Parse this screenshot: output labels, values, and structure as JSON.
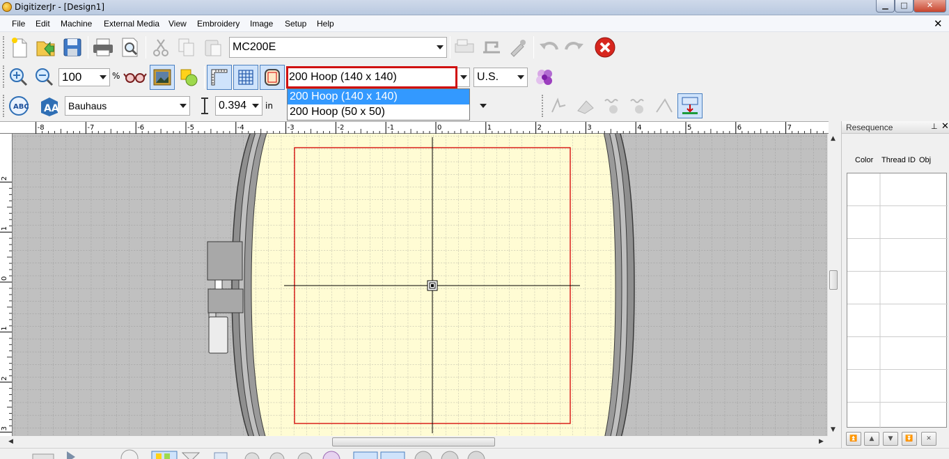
{
  "window": {
    "title": "DigitizerJr - [Design1]",
    "controls": {
      "minimize": "▁",
      "maximize": "□",
      "close": "✕"
    }
  },
  "menu": {
    "items": [
      "File",
      "Edit",
      "Machine",
      "External Media",
      "View",
      "Embroidery",
      "Image",
      "Setup",
      "Help"
    ],
    "doc_close": "✕"
  },
  "toolbar1": {
    "machine_select": "MC200E"
  },
  "toolbar2": {
    "zoom_value": "100",
    "zoom_unit": "%",
    "hoop_select": "200 Hoop (140 x 140)",
    "units_select": "U.S."
  },
  "hoop_dropdown": {
    "options": [
      "200 Hoop (140 x 140)",
      "200 Hoop (50 x 50)"
    ],
    "selected_index": 0
  },
  "toolbar3": {
    "font_select": "Bauhaus",
    "size_value": "0.394",
    "size_unit": "in"
  },
  "ruler": {
    "top_labels": [
      "-8",
      "-7",
      "-6",
      "-5",
      "-4",
      "-3",
      "-2",
      "-1",
      "0",
      "1",
      "2",
      "3",
      "4",
      "5",
      "6",
      "7"
    ],
    "left_labels": [
      "2",
      "1",
      "0",
      "1",
      "2",
      "3"
    ]
  },
  "resequence": {
    "title": "Resequence",
    "columns": [
      "Color",
      "Thread ID",
      "Obj"
    ],
    "pin_icon": "⊥",
    "close_icon": "✕"
  },
  "colors": {
    "hoop_fill": "#fffcd4",
    "hoop_ring": "#8f8f8f",
    "sewing_area": "#d40000",
    "canvas_bg": "#c0c0c0",
    "highlight": "#d01010",
    "selection": "#3399ff"
  }
}
